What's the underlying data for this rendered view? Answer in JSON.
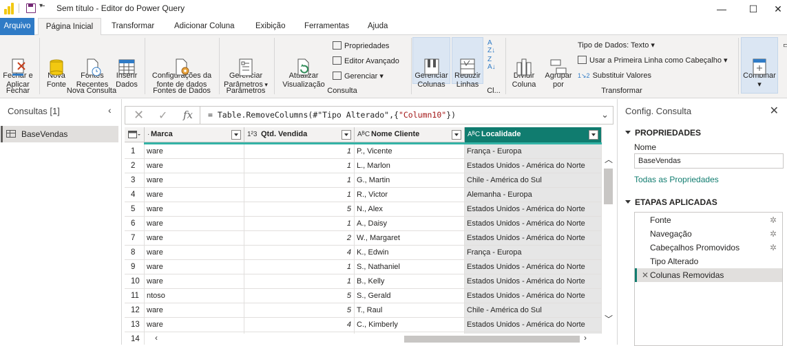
{
  "titlebar": {
    "title": "Sem título - Editor do Power Query"
  },
  "menu": [
    "Arquivo",
    "Página Inicial",
    "Transformar",
    "Adicionar Coluna",
    "Exibição",
    "Ferramentas",
    "Ajuda"
  ],
  "ribbon": {
    "close_apply": "Fechar e\nAplicar",
    "new_source": "Nova\nFonte",
    "recent_sources": "Fontes\nRecentes",
    "enter_data": "Inserir\nDados",
    "data_source_settings": "Configurações da\nfonte de dados",
    "manage_params": "Gerenciar\nParâmetros",
    "refresh_preview": "Atualizar\nVisualização",
    "properties": "Propriedades",
    "advanced_editor": "Editor Avançado",
    "manage": "Gerenciar",
    "manage_columns": "Gerenciar\nColunas",
    "reduce_rows": "Reduzir\nLinhas",
    "split_column": "Dividir\nColuna",
    "group_by": "Agrupar\npor",
    "data_type": "Tipo de Dados: Texto",
    "first_row_header": "Usar a Primeira Linha como Cabeçalho",
    "replace_values": "Substituir Valores",
    "combine": "Combinar",
    "groups": {
      "close": "Fechar",
      "new_query": "Nova Consulta",
      "data_sources": "Fontes de Dados",
      "parameters": "Parâmetros",
      "query": "Consulta",
      "cl": "Cl...",
      "transform": "Transformar"
    }
  },
  "queries": {
    "title": "Consultas [1]",
    "items": [
      "BaseVendas"
    ]
  },
  "formula": {
    "prefix": "= Table.RemoveColumns(#\"Tipo Alterado\",{",
    "string": "\"Column10\"",
    "suffix": "})"
  },
  "grid": {
    "columns": [
      {
        "type_icon": "",
        "name": "Marca"
      },
      {
        "type_icon": "1²3",
        "name": "Qtd. Vendida"
      },
      {
        "type_icon": "AᴮC",
        "name": "Nome Cliente"
      },
      {
        "type_icon": "AᴮC",
        "name": "Localidade"
      }
    ],
    "rows": [
      {
        "i": "1",
        "marca": "ware",
        "qtd": "1",
        "nome": "P., Vicente",
        "loc": "França - Europa"
      },
      {
        "i": "2",
        "marca": "ware",
        "qtd": "1",
        "nome": "L., Marlon",
        "loc": "Estados Unidos - América do Norte"
      },
      {
        "i": "3",
        "marca": "ware",
        "qtd": "1",
        "nome": "G., Martin",
        "loc": "Chile - América do Sul"
      },
      {
        "i": "4",
        "marca": "ware",
        "qtd": "1",
        "nome": "R., Victor",
        "loc": "Alemanha - Europa"
      },
      {
        "i": "5",
        "marca": "ware",
        "qtd": "5",
        "nome": "N., Alex",
        "loc": "Estados Unidos - América do Norte"
      },
      {
        "i": "6",
        "marca": "ware",
        "qtd": "1",
        "nome": "A., Daisy",
        "loc": "Estados Unidos - América do Norte"
      },
      {
        "i": "7",
        "marca": "ware",
        "qtd": "2",
        "nome": "W., Margaret",
        "loc": "Estados Unidos - América do Norte"
      },
      {
        "i": "8",
        "marca": "ware",
        "qtd": "4",
        "nome": "K., Edwin",
        "loc": "França - Europa"
      },
      {
        "i": "9",
        "marca": "ware",
        "qtd": "1",
        "nome": "S., Nathaniel",
        "loc": "Estados Unidos - América do Norte"
      },
      {
        "i": "10",
        "marca": "ware",
        "qtd": "1",
        "nome": "B., Kelly",
        "loc": "Estados Unidos - América do Norte"
      },
      {
        "i": "11",
        "marca": "ntoso",
        "qtd": "5",
        "nome": "S., Gerald",
        "loc": "Estados Unidos - América do Norte"
      },
      {
        "i": "12",
        "marca": "ware",
        "qtd": "5",
        "nome": "T., Raul",
        "loc": "Chile - América do Sul"
      },
      {
        "i": "13",
        "marca": "ware",
        "qtd": "4",
        "nome": "C., Kimberly",
        "loc": "Estados Unidos - América do Norte"
      },
      {
        "i": "14",
        "marca": "",
        "qtd": "",
        "nome": "",
        "loc": ""
      }
    ]
  },
  "settings": {
    "title": "Config. Consulta",
    "properties": "PROPRIEDADES",
    "name_label": "Nome",
    "name_value": "BaseVendas",
    "all_props": "Todas as Propriedades",
    "applied_steps": "ETAPAS APLICADAS",
    "steps": [
      "Fonte",
      "Navegação",
      "Cabeçalhos Promovidos",
      "Tipo Alterado",
      "Colunas Removidas"
    ]
  },
  "colors": {
    "accent": "#107c6f",
    "file_tab": "#2f7bc6",
    "logo": "#f2c811"
  }
}
